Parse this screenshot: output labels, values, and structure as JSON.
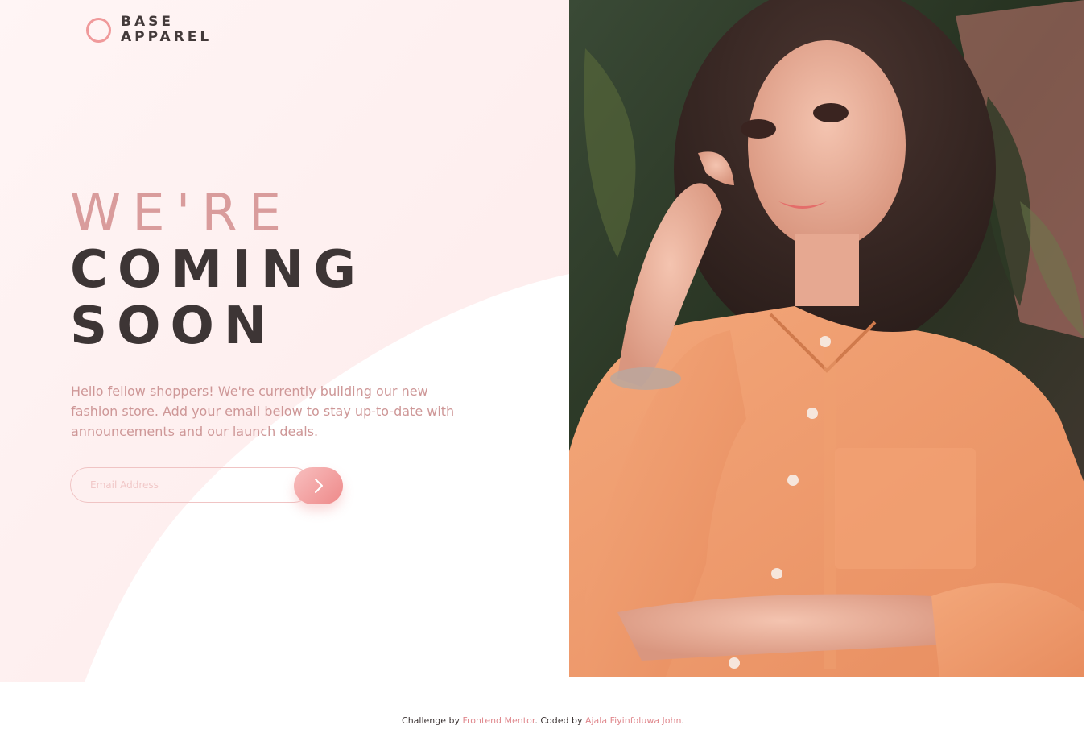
{
  "brand": {
    "line1": "BASE",
    "line2": "APPAREL"
  },
  "headline": {
    "light": "WE'RE",
    "bold_line1": "COMING",
    "bold_line2": "SOON"
  },
  "description": "Hello fellow shoppers! We're currently building our new fashion store. Add your email below to stay up-to-date with announcements and our launch deals.",
  "form": {
    "email_placeholder": "Email Address",
    "email_value": "",
    "submit_icon": "chevron-right-icon"
  },
  "footer": {
    "prefix": "Challenge by ",
    "challenge_link": "Frontend Mentor",
    "middle": ". Coded by ",
    "author_link": "Ajala Fiyinfoluwa John",
    "suffix": "."
  },
  "hero_image": {
    "description_icon": "hero-photo",
    "subject": "woman in orange shirt"
  },
  "colors": {
    "accent": "#f09a9b",
    "text_dark": "#3d3535",
    "text_pink": "#ce9797",
    "background_tint": "#fef5f5"
  }
}
